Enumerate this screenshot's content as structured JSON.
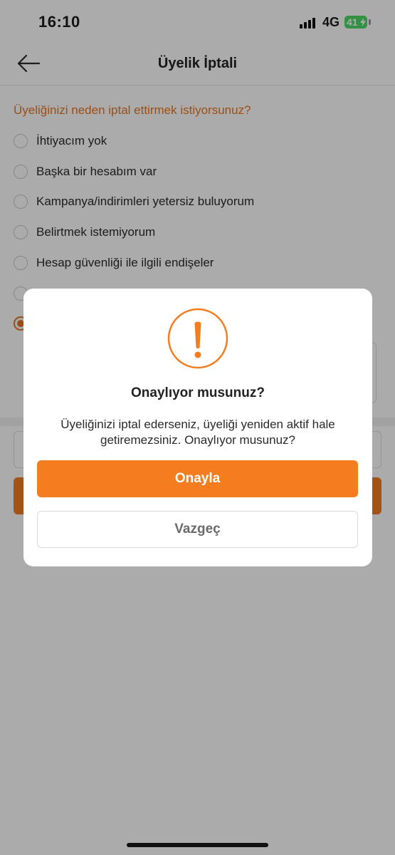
{
  "status_bar": {
    "time": "16:10",
    "network": "4G",
    "battery_level": "41",
    "icons": [
      "signal-icon",
      "battery-icon",
      "charging-bolt-icon"
    ]
  },
  "header": {
    "title": "Üyelik İptali",
    "back_icon": "arrow-left-icon"
  },
  "form": {
    "question": "Üyeliğinizi neden iptal ettirmek istiyorsunuz?",
    "options": [
      {
        "label": "İhtiyacım yok"
      },
      {
        "label": "Başka bir hesabım var"
      },
      {
        "label": "Kampanya/indirimleri yetersiz buluyorum"
      },
      {
        "label": "Belirtmek istemiyorum"
      },
      {
        "label": "Hesap güvenliği ile ilgili endişeler"
      },
      {
        "label": ""
      },
      {
        "label": "",
        "selected": true
      }
    ]
  },
  "dialog": {
    "icon": "exclamation-circle-icon",
    "title": "Onaylıyor musunuz?",
    "message": "Üyeliğinizi iptal ederseniz, üyeliği yeniden aktif hale getiremezsiniz. Onaylıyor musunuz?",
    "confirm_label": "Onayla",
    "cancel_label": "Vazgeç"
  },
  "colors": {
    "accent": "#f47d20",
    "question_text": "#e87722",
    "battery": "#4cd964",
    "overlay": "rgba(0,0,0,0.33)"
  }
}
